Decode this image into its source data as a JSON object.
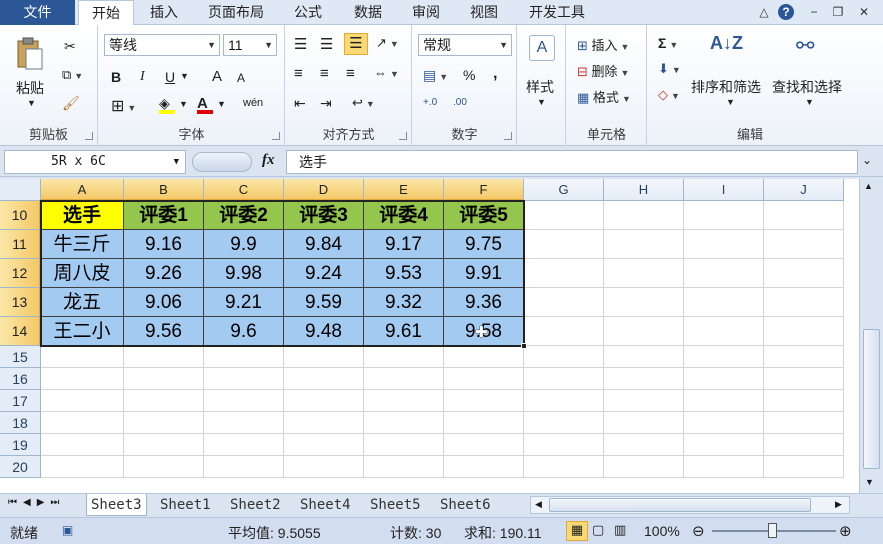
{
  "tabs": [
    "文件",
    "开始",
    "插入",
    "页面布局",
    "公式",
    "数据",
    "审阅",
    "视图",
    "开发工具"
  ],
  "window_controls": {
    "minimize_ribbon": "△",
    "help": "?",
    "minimize": "−",
    "restore": "❐",
    "close": "✕"
  },
  "ribbon": {
    "clipboard": {
      "label": "剪贴板",
      "paste": "粘贴"
    },
    "font": {
      "label": "字体",
      "name": "等线",
      "size": "11",
      "bold": "B",
      "italic": "I",
      "underline": "U",
      "grow": "A",
      "shrink": "A",
      "wen": "wén"
    },
    "alignment": {
      "label": "对齐方式"
    },
    "number": {
      "label": "数字",
      "format": "常规",
      "percent": "%",
      "comma": ","
    },
    "styles": {
      "label": "样式"
    },
    "cells": {
      "label": "单元格",
      "insert": "插入",
      "delete": "删除",
      "format": "格式"
    },
    "editing": {
      "label": "编辑",
      "sigma": "Σ",
      "sort": "排序和筛选",
      "find": "查找和选择"
    }
  },
  "formula_bar": {
    "name_box": "5R x 6C",
    "fx": "fx",
    "value": "选手"
  },
  "columns": [
    "A",
    "B",
    "C",
    "D",
    "E",
    "F",
    "G",
    "H",
    "I",
    "J"
  ],
  "rows": [
    "10",
    "11",
    "12",
    "13",
    "14",
    "15",
    "16",
    "17",
    "18",
    "19",
    "20"
  ],
  "table": {
    "header": [
      "选手",
      "评委1",
      "评委2",
      "评委3",
      "评委4",
      "评委5"
    ],
    "rows": [
      [
        "牛三斤",
        "9.16",
        "9.9",
        "9.84",
        "9.17",
        "9.75"
      ],
      [
        "周八皮",
        "9.26",
        "9.98",
        "9.24",
        "9.53",
        "9.91"
      ],
      [
        "龙五",
        "9.06",
        "9.21",
        "9.59",
        "9.32",
        "9.36"
      ],
      [
        "王二小",
        "9.56",
        "9.6",
        "9.48",
        "9.61",
        "9.58"
      ]
    ]
  },
  "sheets": [
    "Sheet3",
    "Sheet1",
    "Sheet2",
    "Sheet4",
    "Sheet5",
    "Sheet6"
  ],
  "status": {
    "ready": "就绪",
    "average": "平均值: 9.5055",
    "count": "计数: 30",
    "sum": "求和: 190.11",
    "zoom": "100%"
  },
  "colors": {
    "accent": "#2b5797",
    "header_fill": "#94c64d",
    "first_header_fill": "#ffff00",
    "data_fill": "#a3caf0"
  }
}
